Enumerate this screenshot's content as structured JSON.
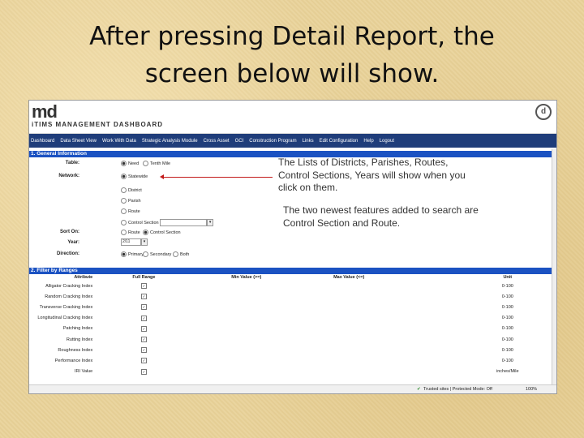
{
  "slide": {
    "title_line1": "After pressing Detail Report, the",
    "title_line2": "screen below will show."
  },
  "app": {
    "logo_text": "md",
    "logo_subtitle": "iTIMS  MANAGEMENT DASHBOARD",
    "menu": [
      "Dashboard",
      "Data Sheet View",
      "Work With Data",
      "Strategic Analysis Module",
      "Cross Asset",
      "GCI",
      "Construction Program",
      "Links",
      "Edit Configuration",
      "Help",
      "Logout"
    ]
  },
  "general": {
    "header": "1. General Information",
    "labels": {
      "table": "Table:",
      "network": "Network:",
      "sort_on": "Sort On:",
      "year": "Year:",
      "direction": "Direction:"
    },
    "table_options": [
      "Need",
      "Tenth Mile"
    ],
    "network_options": [
      "Statewide",
      "District",
      "Parish",
      "Route",
      "Control Section"
    ],
    "sort_options": [
      "Route",
      "Control Section"
    ],
    "year_value": "2/11",
    "direction_options": [
      "Primary",
      "Secondary",
      "Both"
    ]
  },
  "annotation": {
    "line1": "The Lists of Districts, Parishes, Routes,",
    "line2": "Control Sections, Years will show when you",
    "line3": "click on them.",
    "line4": "The two newest features added to search are",
    "line5": "Control Section and Route."
  },
  "ranges": {
    "header": "2. Filter by Ranges",
    "columns": [
      "Attribute",
      "Full Range",
      "Min Value (>=)",
      "Max Value (<=)",
      "Unit"
    ],
    "rows": [
      {
        "attribute": "Alligator Cracking Index",
        "check": "✓",
        "unit": "0-100"
      },
      {
        "attribute": "Random Cracking Index",
        "check": "✓",
        "unit": "0-100"
      },
      {
        "attribute": "Transverse Cracking Index",
        "check": "✓",
        "unit": "0-100"
      },
      {
        "attribute": "Longitudinal Cracking Index",
        "check": "✓",
        "unit": "0-100"
      },
      {
        "attribute": "Patching Index",
        "check": "✓",
        "unit": "0-100"
      },
      {
        "attribute": "Rutting Index",
        "check": "✓",
        "unit": "0-100"
      },
      {
        "attribute": "Roughness Index",
        "check": "✓",
        "unit": "0-100"
      },
      {
        "attribute": "Performance Index",
        "check": "✓",
        "unit": "0-100"
      },
      {
        "attribute": "IRI Value",
        "check": "✓",
        "unit": "inches/Mile"
      }
    ]
  },
  "statusbar": {
    "zone": "Trusted sites | Protected Mode: Off",
    "zoom": "100%"
  }
}
